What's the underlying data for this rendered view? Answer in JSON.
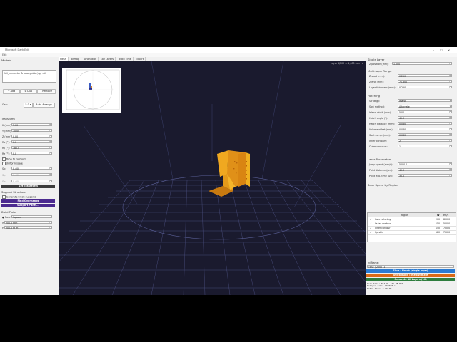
{
  "window": {
    "title": "Microsoft Dark Edit",
    "menu": "Edit"
  },
  "left": {
    "models_heading": "Models",
    "model_file": "foil_connector & base guide (ng) .stl",
    "buttons": {
      "add": "+ Add",
      "dup": "⧉ Dup",
      "remove": "- Remove"
    },
    "gap_label": "Gap:",
    "gap_value": "5.0 ▾",
    "auto_arrange": "Auto Arrange",
    "transform_heading": "Transform",
    "fields": [
      {
        "label": "X (mm):",
        "value": "5.00"
      },
      {
        "label": "Y (mm):",
        "value": "10.00"
      },
      {
        "label": "Z (mm):",
        "value": "0.00"
      },
      {
        "label": "Rx (°):",
        "value": "0.0"
      },
      {
        "label": "Ry (°):",
        "value": "180.0"
      },
      {
        "label": "Rz (°):",
        "value": "0.0"
      }
    ],
    "drop_to_platform": "Drop to platform",
    "uniform_scale": "Uniform scale",
    "scale": [
      {
        "label": "Sx:",
        "value": "0.400"
      },
      {
        "label": "Sy:",
        "value": "0.400"
      },
      {
        "label": "Sz:",
        "value": "0.400"
      }
    ],
    "set_transform": "Set Transform",
    "support_heading": "Support Structure",
    "generate_block": "Generate block supports",
    "find_overhangs": "Find Overhangs",
    "support_panel": "Support Panel...",
    "build_plate_heading": "Build Plate",
    "plate_shape_label": "● Round",
    "plate_shape_value": "Square",
    "plate_dims": [
      {
        "label": "W:",
        "value": "200.0 mm"
      },
      {
        "label": "H:",
        "value": "200.0 m m"
      }
    ]
  },
  "tabs": [
    "Mesh",
    "Bitmap",
    "Animation",
    "3D Layers",
    "Build Time",
    "Export"
  ],
  "active_tab": "Mesh",
  "viewport": {
    "layer_info": "Layer 4/200 — 1,000 mm  ▾ ▴"
  },
  "right": {
    "single_layer_heading": "Single Layer",
    "z_position_label": "Z position (mm):",
    "z_position_value": "1.000",
    "multi_heading": "Multi-layer Range",
    "multi_fields": [
      {
        "label": "Z start (mm):",
        "value": "0.250"
      },
      {
        "label": "Z end (mm):",
        "value": "71.600"
      },
      {
        "label": "Layer thickness (mm):",
        "value": "0.250"
      }
    ],
    "hatching_heading": "Hatching",
    "hatch_fields": [
      {
        "label": "Strategy:",
        "value": "Island",
        "dropdown": true
      },
      {
        "label": "Sort method:",
        "value": "Alternate",
        "dropdown": true
      },
      {
        "label": "Island width (mm):",
        "value": "5.00"
      },
      {
        "label": "Hatch angle (°):",
        "value": "45.0"
      },
      {
        "label": "Hatch distance (mm):",
        "value": "0.080"
      },
      {
        "label": "Volume offset (mm):",
        "value": "0.080"
      },
      {
        "label": "Spot comp. (mm):",
        "value": "0.060"
      },
      {
        "label": "Inner contours:",
        "value": "2"
      },
      {
        "label": "Outer contours:",
        "value": "1"
      }
    ],
    "laser_heading": "Laser Parameters",
    "laser_fields": [
      {
        "label": "Jump speed (mm/s):",
        "value": "5000.0"
      },
      {
        "label": "Point distance (µm):",
        "value": "40.0"
      },
      {
        "label": "Point exp. time (µs):",
        "value": "30.0"
      }
    ],
    "scan_heading": "Scan Speed by Region",
    "table_head": {
      "region": "Region",
      "w": "W",
      "sd": "ert/s"
    },
    "table_rows": [
      {
        "region": "Core hatching",
        "w": "200",
        "sd": "800.0"
      },
      {
        "region": "Outer contour",
        "w": "150",
        "sd": "500.0"
      },
      {
        "region": "Inner contour",
        "w": "150",
        "sd": "700.0"
      },
      {
        "region": "Up skin",
        "w": "180",
        "sd": "700.0"
      }
    ],
    "ini_label": "Ini Name:",
    "ini_value": "TEST / 2000 .1",
    "slice_btn": "Slice - Hatch (single layer)",
    "quick_btn": "Quick Build Time Estimate",
    "generate_btn": "Generate All Layers (10)",
    "stats": [
      "Scan time:      842.0 - 76.28 HT3",
      "Delayer time:   5500.0 s",
      "Total time:     2.85 HT"
    ],
    "colors": {
      "blue": "#2a7bd3",
      "orange": "#d96a18",
      "green": "#2e7d3e",
      "purple": "#4b2a8f"
    }
  }
}
